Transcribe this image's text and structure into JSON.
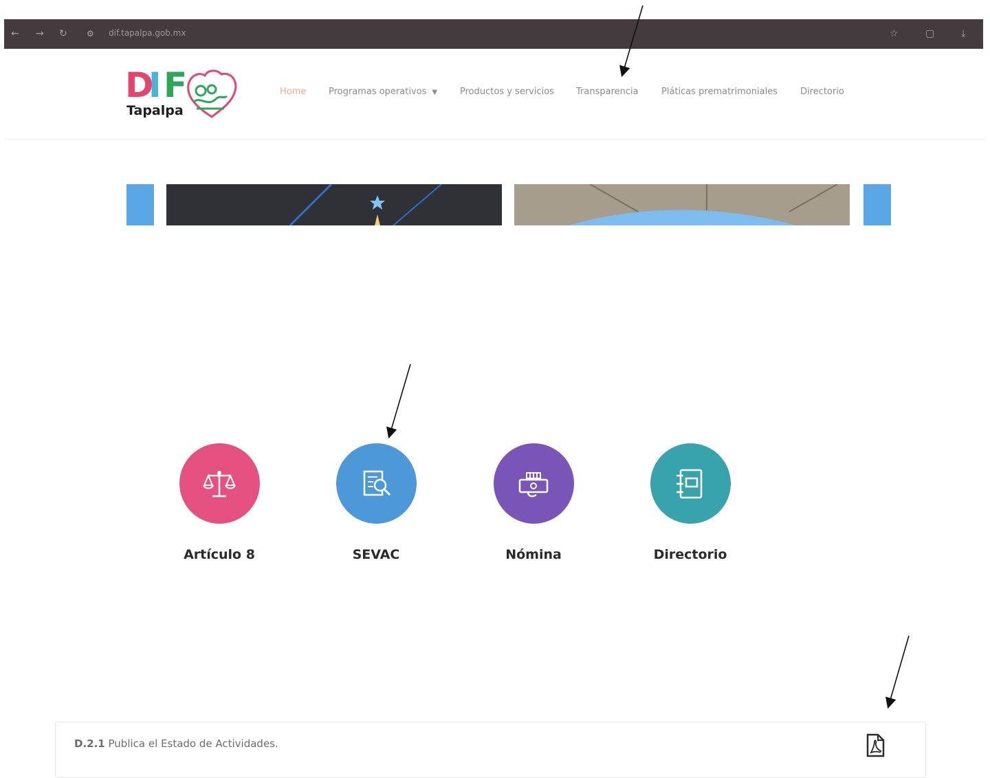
{
  "browser": {
    "url": "dif.tapalpa.gob.mx",
    "back_icon": "arrow-left-icon",
    "forward_icon": "arrow-right-icon",
    "reload_icon": "reload-icon",
    "site_info_icon": "site-settings-icon",
    "bookmark_icon": "star-icon",
    "extensions_icon": "puzzle-icon",
    "download_icon": "download-icon"
  },
  "logo": {
    "letters": [
      "D",
      "I",
      "F"
    ],
    "subtitle": "Tapalpa"
  },
  "nav": {
    "items": [
      {
        "label": "Home",
        "active": true
      },
      {
        "label": "Programas operativos",
        "has_dropdown": true
      },
      {
        "label": "Productos y servicios"
      },
      {
        "label": "Transparencia"
      },
      {
        "label": "Pláticas prematrimoniales"
      },
      {
        "label": "Directorio"
      }
    ]
  },
  "cards": [
    {
      "label": "Artículo 8",
      "color": "#e4507f",
      "icon": "scales-icon"
    },
    {
      "label": "SEVAC",
      "color": "#4d98d9",
      "icon": "document-search-icon"
    },
    {
      "label": "Nómina",
      "color": "#7a55b8",
      "icon": "payroll-hand-icon"
    },
    {
      "label": "Directorio",
      "color": "#38a3ad",
      "icon": "notebook-icon"
    }
  ],
  "document": {
    "code": "D.2.1",
    "text": "Publica el Estado de Actividades.",
    "file_icon": "pdf-icon"
  },
  "colors": {
    "accent_nav": "#f2a58f",
    "browser_bar": "#433b3e"
  }
}
